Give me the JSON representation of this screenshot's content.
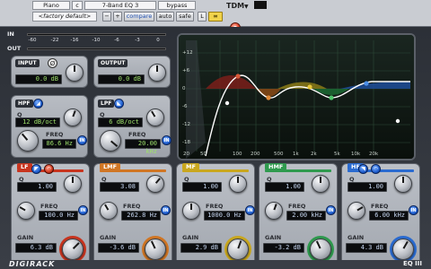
{
  "header": {
    "preset_name": "Piano",
    "slot": "c",
    "plugin": "7-Band EQ 3",
    "bypass": "bypass",
    "setting": "<factory default>",
    "minus": "−",
    "plus": "+",
    "compare": "compare",
    "auto": "auto",
    "safe": "safe",
    "link_L": "L",
    "link_icon": "∞",
    "tdm": "TDM",
    "tdm_arrow": "▼"
  },
  "meters": {
    "in_label": "IN",
    "out_label": "OUT",
    "scale": [
      "-60",
      "-22",
      "-16",
      "-10",
      "-6",
      "-3",
      "0"
    ]
  },
  "input": {
    "label": "INPUT",
    "value": "0.0 dB",
    "phase_icon": "Ø"
  },
  "output": {
    "label": "OUTPUT",
    "value": "0.0 dB"
  },
  "hpf": {
    "label": "HPF",
    "q_label": "Q",
    "q_value": "12 dB/oct",
    "freq_label": "FREQ",
    "freq_value": "86.6 Hz",
    "in": "IN"
  },
  "lpf": {
    "label": "LPF",
    "q_label": "Q",
    "q_value": "6 dB/oct",
    "freq_label": "FREQ",
    "freq_value": "20.00 kHz",
    "in": "IN"
  },
  "graph": {
    "y_labels": [
      "+12",
      "+6",
      "0",
      "-6",
      "-12",
      "-18"
    ],
    "x_labels": [
      "20",
      "50",
      "100",
      "200",
      "500",
      "1k",
      "2k",
      "5k",
      "10k",
      "20k"
    ]
  },
  "bands": [
    {
      "id": "lf",
      "label": "LF",
      "color": "#c8351f",
      "q": "1.00",
      "freq": "100.0 Hz",
      "gain": "6.3 dB",
      "q_label": "Q",
      "freq_label": "FREQ",
      "gain_label": "GAIN",
      "in": "IN"
    },
    {
      "id": "lmf",
      "label": "LMF",
      "color": "#d07624",
      "q": "3.08",
      "freq": "262.8 Hz",
      "gain": "-3.6 dB",
      "q_label": "Q",
      "freq_label": "FREQ",
      "gain_label": "GAIN",
      "in": "IN"
    },
    {
      "id": "mf",
      "label": "MF",
      "color": "#c9a71e",
      "q": "1.00",
      "freq": "1000.0 Hz",
      "gain": "2.9 dB",
      "q_label": "Q",
      "freq_label": "FREQ",
      "gain_label": "GAIN",
      "in": "IN"
    },
    {
      "id": "hmf",
      "label": "HMF",
      "color": "#2f9a4e",
      "q": "1.00",
      "freq": "2.00 kHz",
      "gain": "-3.2 dB",
      "q_label": "Q",
      "freq_label": "FREQ",
      "gain_label": "GAIN",
      "in": "IN"
    },
    {
      "id": "hf",
      "label": "HF",
      "color": "#2a6bd0",
      "q": "1.00",
      "freq": "6.00 kHz",
      "gain": "4.3 dB",
      "q_label": "Q",
      "freq_label": "FREQ",
      "gain_label": "GAIN",
      "in": "IN"
    }
  ],
  "footer": {
    "brand": "DIGIRACK",
    "model": "EQ III"
  }
}
